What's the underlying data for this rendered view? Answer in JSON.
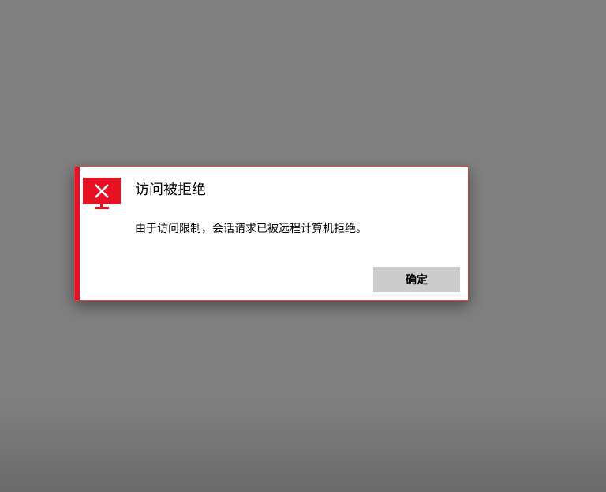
{
  "dialog": {
    "title": "访问被拒绝",
    "message": "由于访问限制，会话请求已被远程计算机拒绝。",
    "icon": "error-monitor-icon",
    "ok_label": "确定",
    "accent_color": "#e81123"
  },
  "desktop": {
    "background_color": "#808080"
  }
}
